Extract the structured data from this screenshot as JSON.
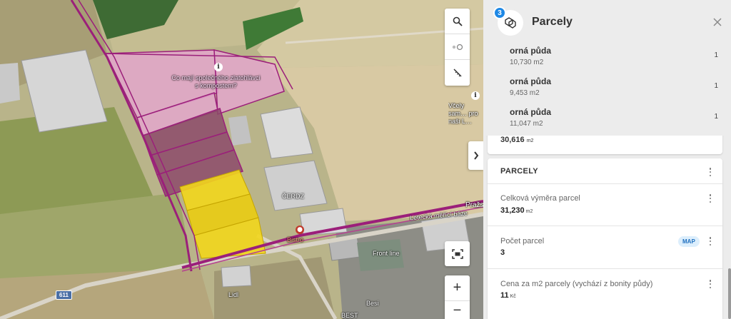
{
  "map": {
    "labels": {
      "compost": "Co mají společného zlatohlávci s kompostem?",
      "bees": "Včely sam… pro naši L…",
      "cerdz": "ČERDZ",
      "prazska": "Pražs",
      "letecka": "Letecká měřící báze",
      "bistro": "Bistro",
      "frontline": "Front line",
      "lidl": "Lidl",
      "best": "BEST",
      "besi": "Besi"
    },
    "road_shield": "611",
    "toolbar": {
      "search_icon": "search-icon",
      "toggle_icon": "layer-toggle-icon",
      "measure_icon": "ruler-icon"
    },
    "collapse_icon": "chevron-right-icon",
    "fit_icon": "fit-screen-icon",
    "zoom_in": "+",
    "zoom_out": "−"
  },
  "panel": {
    "badge": "3",
    "icon": "parcels-icon",
    "title": "Parcely",
    "parcels": [
      {
        "type": "orná půda",
        "area": "10,730 m2",
        "count": "1"
      },
      {
        "type": "orná půda",
        "area": "9,453 m2",
        "count": "1"
      },
      {
        "type": "orná půda",
        "area": "11,047 m2",
        "count": "1"
      }
    ],
    "peek_value": "30,616",
    "peek_unit": "m2",
    "card": {
      "title": "PARCELY",
      "rows": [
        {
          "label": "Celková výměra parcel",
          "value": "31,230",
          "unit": "m2"
        },
        {
          "label": "Počet parcel",
          "value": "3",
          "pill": "MAP"
        },
        {
          "label": "Cena za m2 parcely (vychází z bonity půdy)",
          "value": "11",
          "unit": "Kč"
        }
      ]
    }
  },
  "colors": {
    "parcel_pink": "#e6a6cf",
    "parcel_dark": "#8c4a6a",
    "parcel_yellow": "#f2d61c",
    "boundary": "#9b1f7a",
    "accent": "#1e88e5"
  }
}
